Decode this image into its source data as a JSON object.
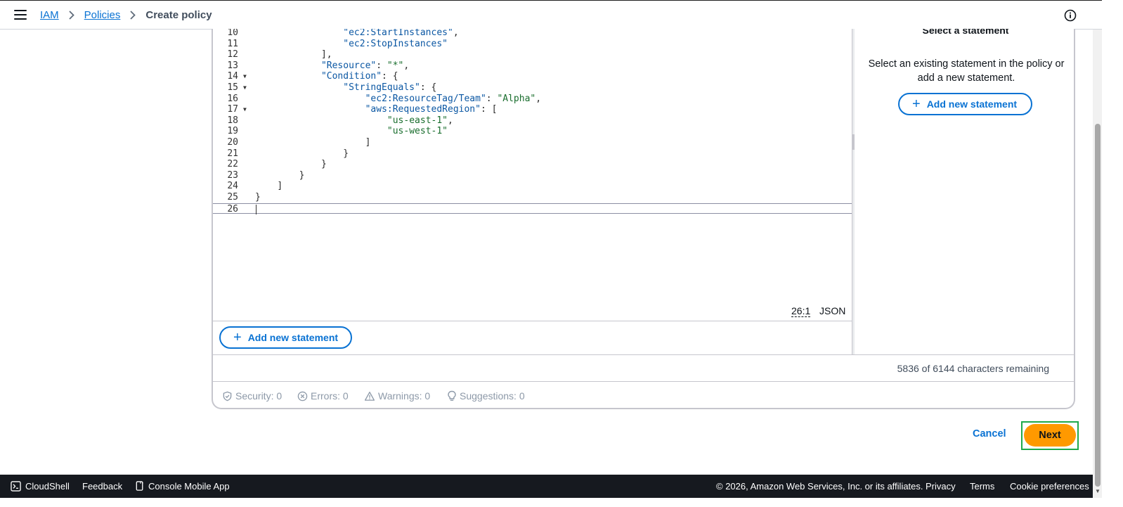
{
  "header": {
    "menu_icon": "hamburger-menu-icon",
    "breadcrumbs": [
      {
        "label": "IAM",
        "link": true
      },
      {
        "label": "Policies",
        "link": true
      },
      {
        "label": "Create policy",
        "link": false
      }
    ],
    "info_icon": "info-icon"
  },
  "editor": {
    "lines": [
      {
        "n": "10",
        "fold": false,
        "indent": 16,
        "tokens": [
          {
            "t": "\"ec2:StartInstances\"",
            "c": "key"
          },
          {
            "t": ",",
            "c": "punc"
          }
        ]
      },
      {
        "n": "11",
        "fold": false,
        "indent": 16,
        "tokens": [
          {
            "t": "\"ec2:StopInstances\"",
            "c": "key"
          }
        ]
      },
      {
        "n": "12",
        "fold": false,
        "indent": 12,
        "tokens": [
          {
            "t": "],",
            "c": "punc"
          }
        ]
      },
      {
        "n": "13",
        "fold": false,
        "indent": 12,
        "tokens": [
          {
            "t": "\"Resource\"",
            "c": "key"
          },
          {
            "t": ": ",
            "c": "punc"
          },
          {
            "t": "\"*\"",
            "c": "str"
          },
          {
            "t": ",",
            "c": "punc"
          }
        ]
      },
      {
        "n": "14",
        "fold": true,
        "indent": 12,
        "tokens": [
          {
            "t": "\"Condition\"",
            "c": "key"
          },
          {
            "t": ": {",
            "c": "punc"
          }
        ]
      },
      {
        "n": "15",
        "fold": true,
        "indent": 16,
        "tokens": [
          {
            "t": "\"StringEquals\"",
            "c": "key"
          },
          {
            "t": ": {",
            "c": "punc"
          }
        ]
      },
      {
        "n": "16",
        "fold": false,
        "indent": 20,
        "tokens": [
          {
            "t": "\"ec2:ResourceTag/Team\"",
            "c": "key"
          },
          {
            "t": ": ",
            "c": "punc"
          },
          {
            "t": "\"Alpha\"",
            "c": "str"
          },
          {
            "t": ",",
            "c": "punc"
          }
        ]
      },
      {
        "n": "17",
        "fold": true,
        "indent": 20,
        "tokens": [
          {
            "t": "\"aws:RequestedRegion\"",
            "c": "key"
          },
          {
            "t": ": [",
            "c": "punc"
          }
        ]
      },
      {
        "n": "18",
        "fold": false,
        "indent": 24,
        "tokens": [
          {
            "t": "\"us-east-1\"",
            "c": "str"
          },
          {
            "t": ",",
            "c": "punc"
          }
        ]
      },
      {
        "n": "19",
        "fold": false,
        "indent": 24,
        "tokens": [
          {
            "t": "\"us-west-1\"",
            "c": "str"
          }
        ]
      },
      {
        "n": "20",
        "fold": false,
        "indent": 20,
        "tokens": [
          {
            "t": "]",
            "c": "punc"
          }
        ]
      },
      {
        "n": "21",
        "fold": false,
        "indent": 16,
        "tokens": [
          {
            "t": "}",
            "c": "punc"
          }
        ]
      },
      {
        "n": "22",
        "fold": false,
        "indent": 12,
        "tokens": [
          {
            "t": "}",
            "c": "punc"
          }
        ]
      },
      {
        "n": "23",
        "fold": false,
        "indent": 8,
        "tokens": [
          {
            "t": "}",
            "c": "punc"
          }
        ]
      },
      {
        "n": "24",
        "fold": false,
        "indent": 4,
        "tokens": [
          {
            "t": "]",
            "c": "punc"
          }
        ]
      },
      {
        "n": "25",
        "fold": false,
        "indent": 0,
        "tokens": [
          {
            "t": "}",
            "c": "punc"
          }
        ]
      },
      {
        "n": "26",
        "fold": false,
        "indent": 0,
        "tokens": [],
        "active": true
      }
    ],
    "cursor_position": "26:1",
    "language": "JSON",
    "add_statement_label": "Add new statement"
  },
  "side_panel": {
    "title": "Select a statement",
    "description": "Select an existing statement in the policy or add a new statement.",
    "add_statement_label": "Add new statement"
  },
  "characters_remaining": "5836 of 6144 characters remaining",
  "checks": [
    {
      "icon": "shield-icon",
      "label": "Security: 0"
    },
    {
      "icon": "error-x-icon",
      "label": "Errors: 0"
    },
    {
      "icon": "warning-triangle-icon",
      "label": "Warnings: 0"
    },
    {
      "icon": "lightbulb-icon",
      "label": "Suggestions: 0"
    }
  ],
  "actions": {
    "cancel_label": "Cancel",
    "next_label": "Next"
  },
  "footer": {
    "cloudshell_label": "CloudShell",
    "feedback_label": "Feedback",
    "mobile_app_label": "Console Mobile App",
    "copyright": "© 2026, Amazon Web Services, Inc. or its affiliates.",
    "privacy_label": "Privacy",
    "terms_label": "Terms",
    "cookie_label": "Cookie preferences"
  },
  "colors": {
    "link": "#0972d3",
    "primary_button": "#ff9900",
    "footer_bg": "#16191f",
    "highlight_outline": "#1fa94a"
  }
}
